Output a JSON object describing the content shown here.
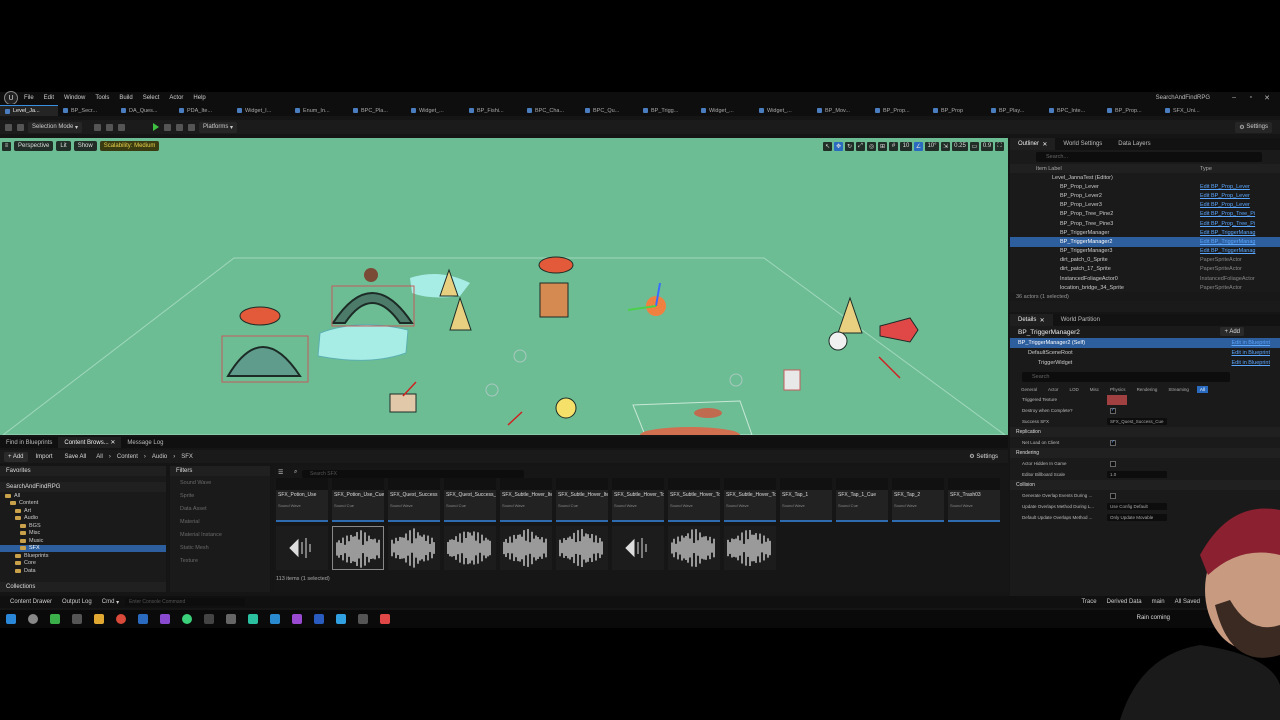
{
  "menu": {
    "items": [
      "File",
      "Edit",
      "Window",
      "Tools",
      "Build",
      "Select",
      "Actor",
      "Help"
    ],
    "project_name": "SearchAndFindRPG"
  },
  "tabs": [
    "Level_Ja...",
    "BP_Secr...",
    "DA_Ques...",
    "PDA_Ite...",
    "Widget_I...",
    "Enum_In...",
    "BPC_Pla...",
    "Widget_...",
    "BP_Fishi...",
    "BPC_Cha...",
    "BPC_Qu...",
    "BP_Trigg...",
    "Widget_...",
    "Widget_...",
    "BP_Mov...",
    "BP_Prop...",
    "BP_Prop",
    "BP_Play...",
    "BPC_Inte...",
    "BP_Prop...",
    "SFX_Uni..."
  ],
  "toolbar": {
    "selection_mode": "Selection Mode",
    "platforms": "Platforms",
    "settings": "Settings"
  },
  "viewport": {
    "perspective": "Perspective",
    "lit": "Lit",
    "show": "Show",
    "scalability": "Scalability: Medium",
    "grid_snap": "10",
    "rot_snap": "10°",
    "scale_snap": "0.25",
    "cam_speed": "0.9"
  },
  "outliner": {
    "tabs": [
      "Outliner",
      "World Settings",
      "Data Layers"
    ],
    "search_placeholder": "Search...",
    "col_label": "Item Label",
    "col_type": "Type",
    "rows": [
      {
        "label": "Level_JannaTest (Editor)",
        "type": ""
      },
      {
        "label": "BP_Prop_Lever",
        "type": "Edit BP_Prop_Lever"
      },
      {
        "label": "BP_Prop_Lever2",
        "type": "Edit BP_Prop_Lever"
      },
      {
        "label": "BP_Prop_Lever3",
        "type": "Edit BP_Prop_Lever"
      },
      {
        "label": "BP_Prop_Tree_Pine2",
        "type": "Edit BP_Prop_Tree_Pi"
      },
      {
        "label": "BP_Prop_Tree_Pine3",
        "type": "Edit BP_Prop_Tree_Pi"
      },
      {
        "label": "BP_TriggerManager",
        "type": "Edit BP_TriggerManag"
      },
      {
        "label": "BP_TriggerManager2",
        "type": "Edit BP_TriggerManag"
      },
      {
        "label": "BP_TriggerManager3",
        "type": "Edit BP_TriggerManag"
      },
      {
        "label": "dirt_patch_0_Sprite",
        "type": "PaperSpriteActor"
      },
      {
        "label": "dirt_patch_17_Sprite",
        "type": "PaperSpriteActor"
      },
      {
        "label": "InstancedFoliageActor0",
        "type": "InstancedFoliageActor"
      },
      {
        "label": "location_bridge_34_Sprite",
        "type": "PaperSpriteActor"
      }
    ],
    "footer": "36 actors (1 selected)"
  },
  "details": {
    "tabs": [
      "Details",
      "World Partition"
    ],
    "title": "BP_TriggerManager2",
    "add_label": "+ Add",
    "components": [
      {
        "label": "BP_TriggerManager2 (Self)",
        "link": "Edit in Blueprint"
      },
      {
        "label": "DefaultSceneRoot",
        "link": "Edit in Blueprint"
      },
      {
        "label": "TriggerWidget",
        "link": "Edit in Blueprint"
      }
    ],
    "search_placeholder": "Search",
    "filters": [
      "General",
      "Actor",
      "LOD",
      "Misc",
      "Physics",
      "Rendering",
      "Streaming",
      "All"
    ],
    "props": [
      {
        "name": "Triggered Texture",
        "value": ""
      },
      {
        "name": "Destroy when Complete?",
        "value": "check"
      },
      {
        "name": "Success SFX",
        "value": "SFX_Quest_Success_Cue"
      }
    ],
    "sections": [
      {
        "title": "Replication",
        "props": [
          {
            "name": "Net Load on Client",
            "value": "check"
          }
        ]
      },
      {
        "title": "Rendering",
        "props": [
          {
            "name": "Actor Hidden In Game",
            "value": "box"
          },
          {
            "name": "Editor Billboard Scale",
            "value": "1.0"
          }
        ]
      },
      {
        "title": "Collision",
        "props": [
          {
            "name": "Generate Overlap Events During ...",
            "value": "box"
          },
          {
            "name": "Update Overlaps Method During L...",
            "value": "Use Config Default"
          },
          {
            "name": "Default Update Overlaps Method ...",
            "value": "Only Update Movable"
          }
        ]
      }
    ]
  },
  "bottom_tabs": [
    "Find in Blueprints",
    "Content Brows...",
    "Message Log"
  ],
  "content_browser": {
    "add": "+ Add",
    "import": "Import",
    "save_all": "Save All",
    "breadcrumb": [
      "All",
      "Content",
      "Audio",
      "SFX"
    ],
    "settings": "Settings",
    "favorites": "Favorites",
    "project": "SearchAndFindRPG",
    "tree": [
      {
        "label": "All",
        "level": 1,
        "sel": false
      },
      {
        "label": "Content",
        "level": 2,
        "sel": false
      },
      {
        "label": "Art",
        "level": 3,
        "sel": false
      },
      {
        "label": "Audio",
        "level": 3,
        "sel": false
      },
      {
        "label": "BGS",
        "level": 4,
        "sel": false
      },
      {
        "label": "Misc",
        "level": 4,
        "sel": false
      },
      {
        "label": "Music",
        "level": 4,
        "sel": false
      },
      {
        "label": "SFX",
        "level": 4,
        "sel": true
      },
      {
        "label": "Blueprints",
        "level": 3,
        "sel": false
      },
      {
        "label": "Core",
        "level": 3,
        "sel": false
      },
      {
        "label": "Data",
        "level": 3,
        "sel": false
      }
    ],
    "collections": "Collections",
    "filters_title": "Filters",
    "filter_items": [
      "Sound Wave",
      "Sprite",
      "Data Asset",
      "Material",
      "Material Instance",
      "Static Mesh",
      "Texture"
    ],
    "search_placeholder": "Search SFX",
    "assets_row1": [
      {
        "name": "SFX_Potion_Use",
        "kind": "Sound Wave"
      },
      {
        "name": "SFX_Potion_Use_Cue",
        "kind": "Sound Cue"
      },
      {
        "name": "SFX_Quest_Success",
        "kind": "Sound Wave"
      },
      {
        "name": "SFX_Quest_Success_Cue",
        "kind": "Sound Cue"
      },
      {
        "name": "SFX_Subtle_Hover_Items",
        "kind": "Sound Wave"
      },
      {
        "name": "SFX_Subtle_Hover_Items_Cue",
        "kind": "Sound Cue"
      },
      {
        "name": "SFX_Subtle_Hover_Touch_Stone_1",
        "kind": "Sound Wave"
      },
      {
        "name": "SFX_Subtle_Hover_Touch_Stone_2",
        "kind": "Sound Wave"
      },
      {
        "name": "SFX_Subtle_Hover_Touch_Stone_3",
        "kind": "Sound Wave"
      },
      {
        "name": "SFX_Tap_1",
        "kind": "Sound Wave"
      },
      {
        "name": "SFX_Tap_1_Cue",
        "kind": "Sound Cue"
      },
      {
        "name": "SFX_Tap_2",
        "kind": "Sound Wave"
      },
      {
        "name": "SFX_Trash03",
        "kind": "Sound Wave"
      }
    ],
    "count": "113 items (1 selected)"
  },
  "statusbar": {
    "content_drawer": "Content Drawer",
    "output_log": "Output Log",
    "cmd": "Cmd",
    "console_placeholder": "Enter Console Command",
    "trace": "Trace",
    "derived_data": "Derived Data",
    "source_control": "main",
    "saved": "All Saved"
  },
  "taskbar": {
    "weather": "Rain coming"
  }
}
